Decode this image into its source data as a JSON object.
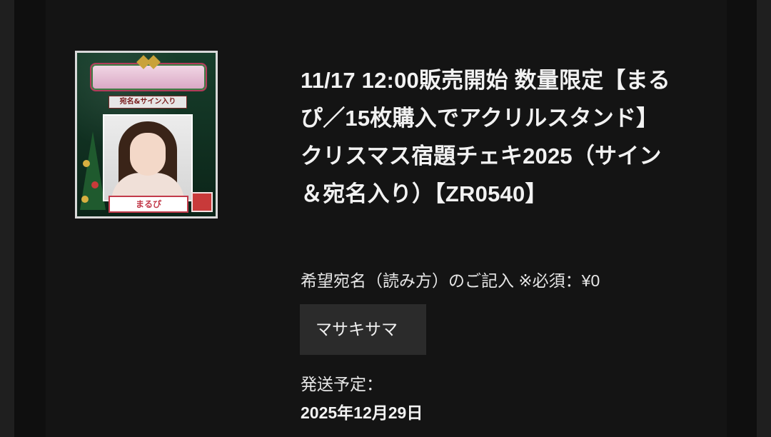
{
  "product": {
    "title": "11/17 12:00販売開始 数量限定【まるぴ／15枚購入でアクリルスタンド】 クリスマス宿題チェキ2025（サイン＆宛名入り）【ZR0540】",
    "image": {
      "badge_text": "宛名&サイン入り",
      "name_card": "まるぴ"
    }
  },
  "form": {
    "field_label": "希望宛名（読み方）のご記入 ※必須：¥0",
    "field_value": "マサキサマ"
  },
  "shipping": {
    "label": "発送予定：",
    "date": "2025年12月29日"
  },
  "colors": {
    "background": "#141414",
    "input_background": "#2b2b2b",
    "text": "#f2f2f2"
  }
}
